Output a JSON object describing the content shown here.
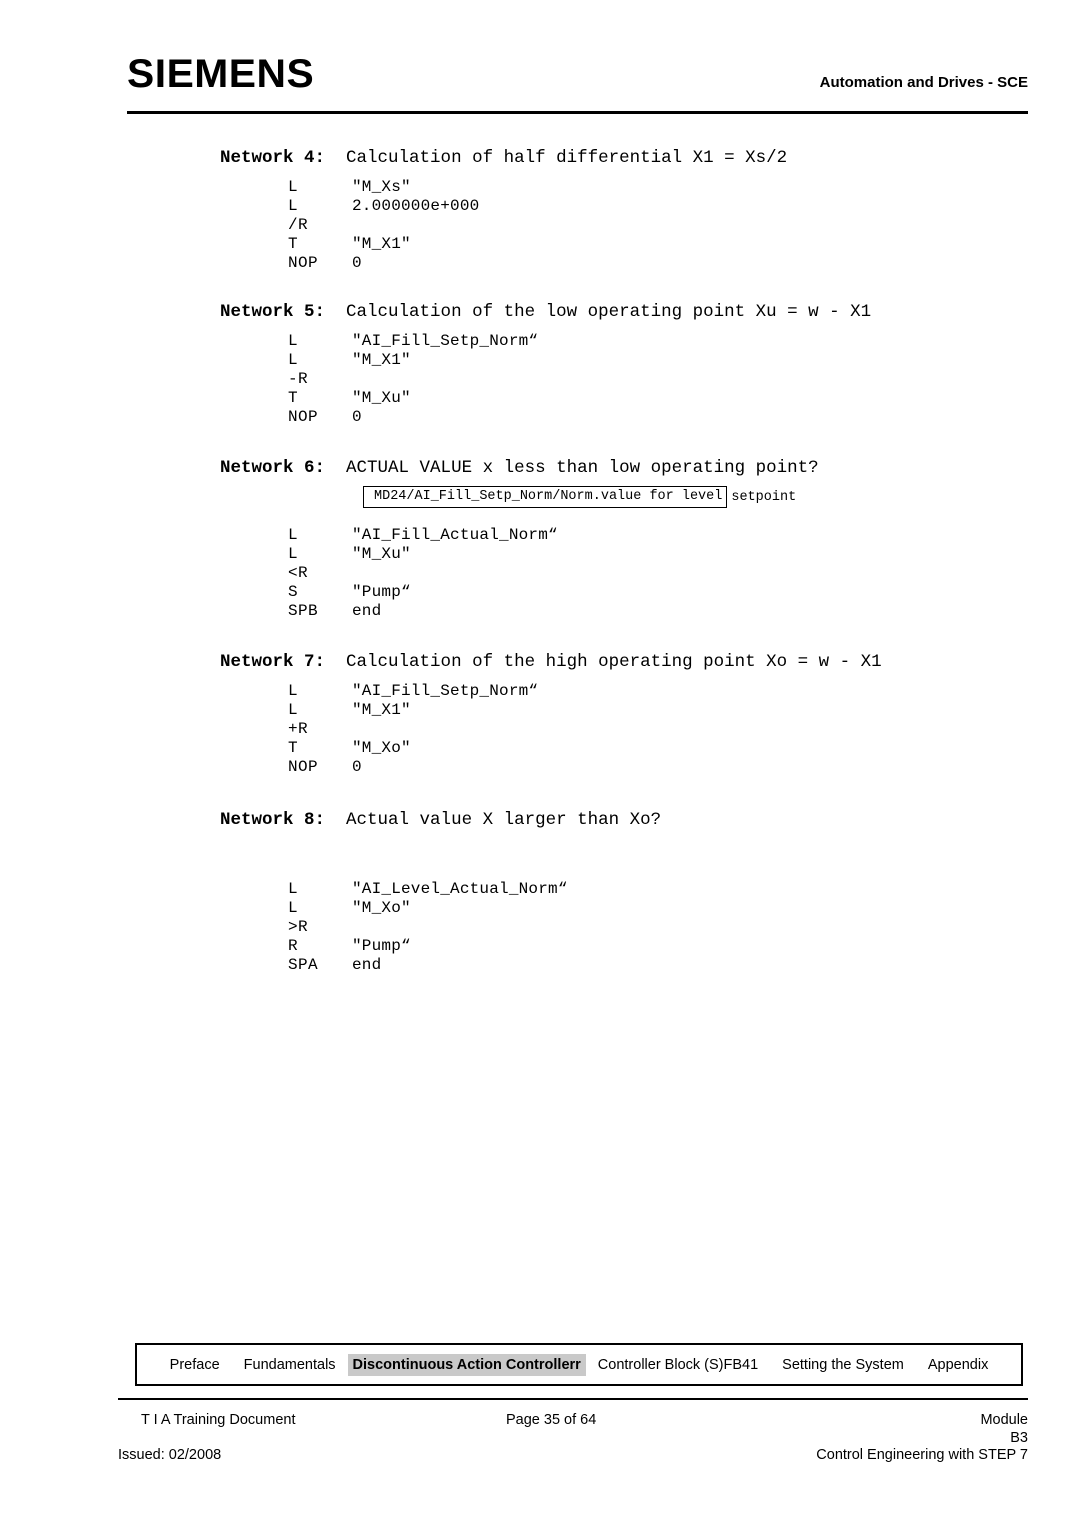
{
  "header": {
    "logo": "SIEMENS",
    "right_title": "Automation and Drives - SCE"
  },
  "networks": [
    {
      "id": "network-4",
      "label": "Network 4:",
      "title": "Calculation of half differential X1 = Xs/2",
      "lines": [
        {
          "op": "L",
          "operand": "\"M_Xs\""
        },
        {
          "op": "L",
          "operand": "2.000000e+000"
        },
        {
          "op": "/R",
          "operand": ""
        },
        {
          "op": "T",
          "operand": "\"M_X1\""
        },
        {
          "op": "NOP",
          "operand": "0"
        }
      ]
    },
    {
      "id": "network-5",
      "label": "Network 5:",
      "title": "Calculation of the low operating point Xu = w - X1",
      "lines": [
        {
          "op": "L",
          "operand": "\"AI_Fill_Setp_Norm“"
        },
        {
          "op": "L",
          "operand": "\"M_X1\""
        },
        {
          "op": "-R",
          "operand": ""
        },
        {
          "op": "T",
          "operand": "\"M_Xu\""
        },
        {
          "op": "NOP",
          "operand": "0"
        }
      ]
    },
    {
      "id": "network-6",
      "label": "Network 6:",
      "title": "ACTUAL VALUE x less than low operating point?",
      "callout": {
        "boxed_text": "MD24/AI_Fill_Setp_Norm/Norm.value for level",
        "trailing_text": "setpoint"
      },
      "lines": [
        {
          "op": "L",
          "operand": "\"AI_Fill_Actual_Norm“"
        },
        {
          "op": "L",
          "operand": "\"M_Xu\""
        },
        {
          "op": "<R",
          "operand": ""
        },
        {
          "op": "S",
          "operand": "\"Pump“"
        },
        {
          "op": "SPB",
          "operand": "end"
        }
      ]
    },
    {
      "id": "network-7",
      "label": "Network 7:",
      "title": "Calculation of the high operating point Xo = w - X1",
      "lines": [
        {
          "op": "L",
          "operand": "\"AI_Fill_Setp_Norm“"
        },
        {
          "op": "L",
          "operand": "\"M_X1\""
        },
        {
          "op": "+R",
          "operand": ""
        },
        {
          "op": "T",
          "operand": "\"M_Xo\""
        },
        {
          "op": "NOP",
          "operand": "0"
        }
      ]
    },
    {
      "id": "network-8",
      "label": "Network 8:",
      "title": "Actual value X larger than Xo?",
      "lines": [
        {
          "op": "L",
          "operand": "\"AI_Level_Actual_Norm“"
        },
        {
          "op": "L",
          "operand": "\"M_Xo\""
        },
        {
          "op": ">R",
          "operand": ""
        },
        {
          "op": "R",
          "operand": "\"Pump“"
        },
        {
          "op": "SPA",
          "operand": "end"
        }
      ]
    }
  ],
  "footer_nav": {
    "items": [
      {
        "label": "Preface",
        "active": false
      },
      {
        "label": "Fundamentals",
        "active": false
      },
      {
        "label": "Discontinuous Action Controllerr",
        "active": true
      },
      {
        "label": "Controller Block (S)FB41",
        "active": false
      },
      {
        "label": "Setting the System",
        "active": false
      },
      {
        "label": "Appendix",
        "active": false
      }
    ]
  },
  "footer": {
    "document_name": "T I A  Training Document",
    "page_number": "Page 35 of 64",
    "module_label": "Module",
    "module_value": "B3",
    "issued": "Issued: 02/2008",
    "course": "Control Engineering with STEP 7"
  }
}
